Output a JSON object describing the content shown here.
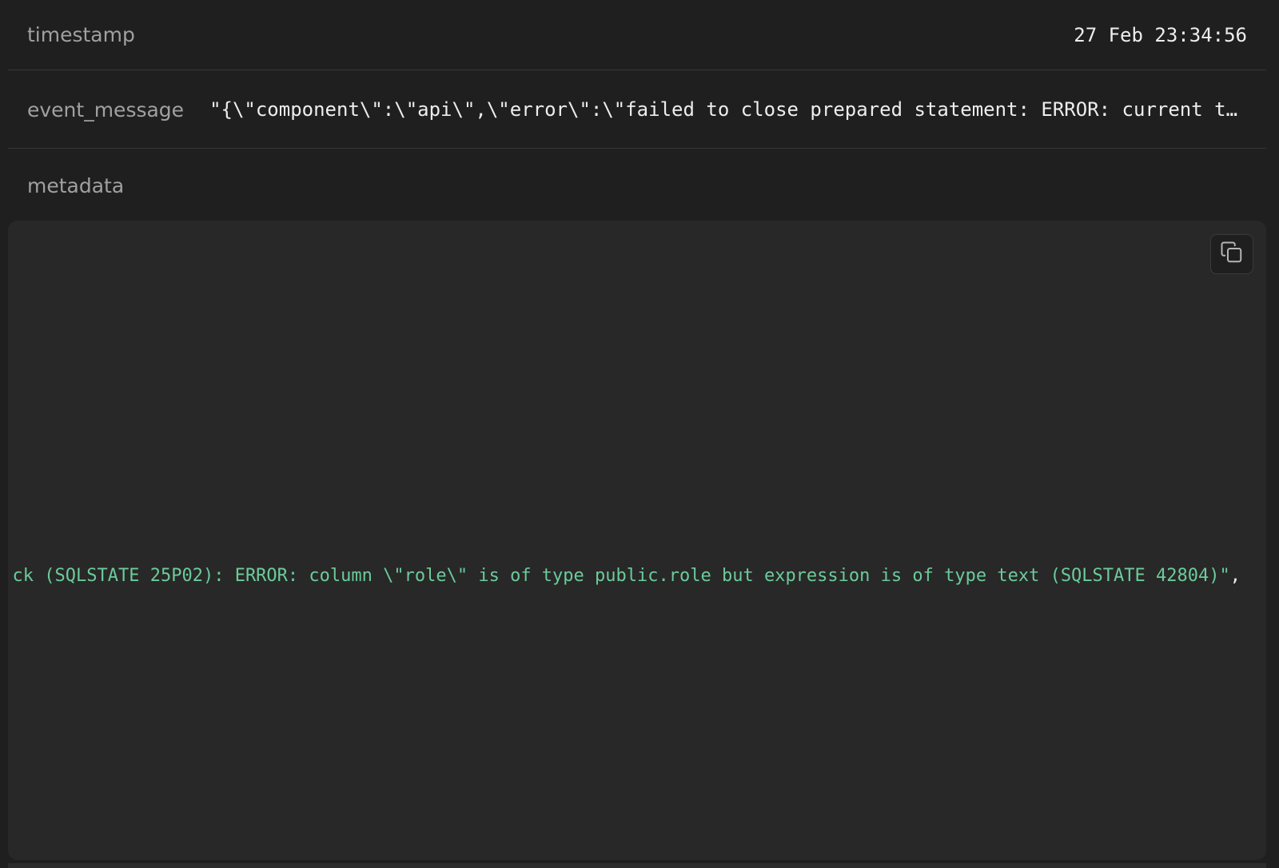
{
  "fields": {
    "timestamp": {
      "label": "timestamp",
      "value": "27 Feb 23:34:56"
    },
    "event_message": {
      "label": "event_message",
      "value": "\"{\\\"component\\\":\\\"api\\\",\\\"error\\\":\\\"failed to close prepared statement: ERROR: current transaction is aborted, commands ignored until end of transaction block (SQLSTATE 25P02): ERROR: column \\\"role\\\" is of type public.role but expression is of type text (SQLSTATE 42804)\\\"}\""
    },
    "metadata": {
      "label": "metadata"
    }
  },
  "metadata_view": {
    "visible_line": "ck (SQLSTATE 25P02): ERROR: column \\\"role\\\" is of type public.role but expression is of type text (SQLSTATE 42804)\"",
    "trailing_punct": ",",
    "copy_icon": "copy-icon"
  },
  "colors": {
    "background": "#1f1f1f",
    "code_background": "#282828",
    "string_green": "#6ccb9a",
    "label_gray": "#a0a0a0",
    "value_white": "#ededed"
  }
}
